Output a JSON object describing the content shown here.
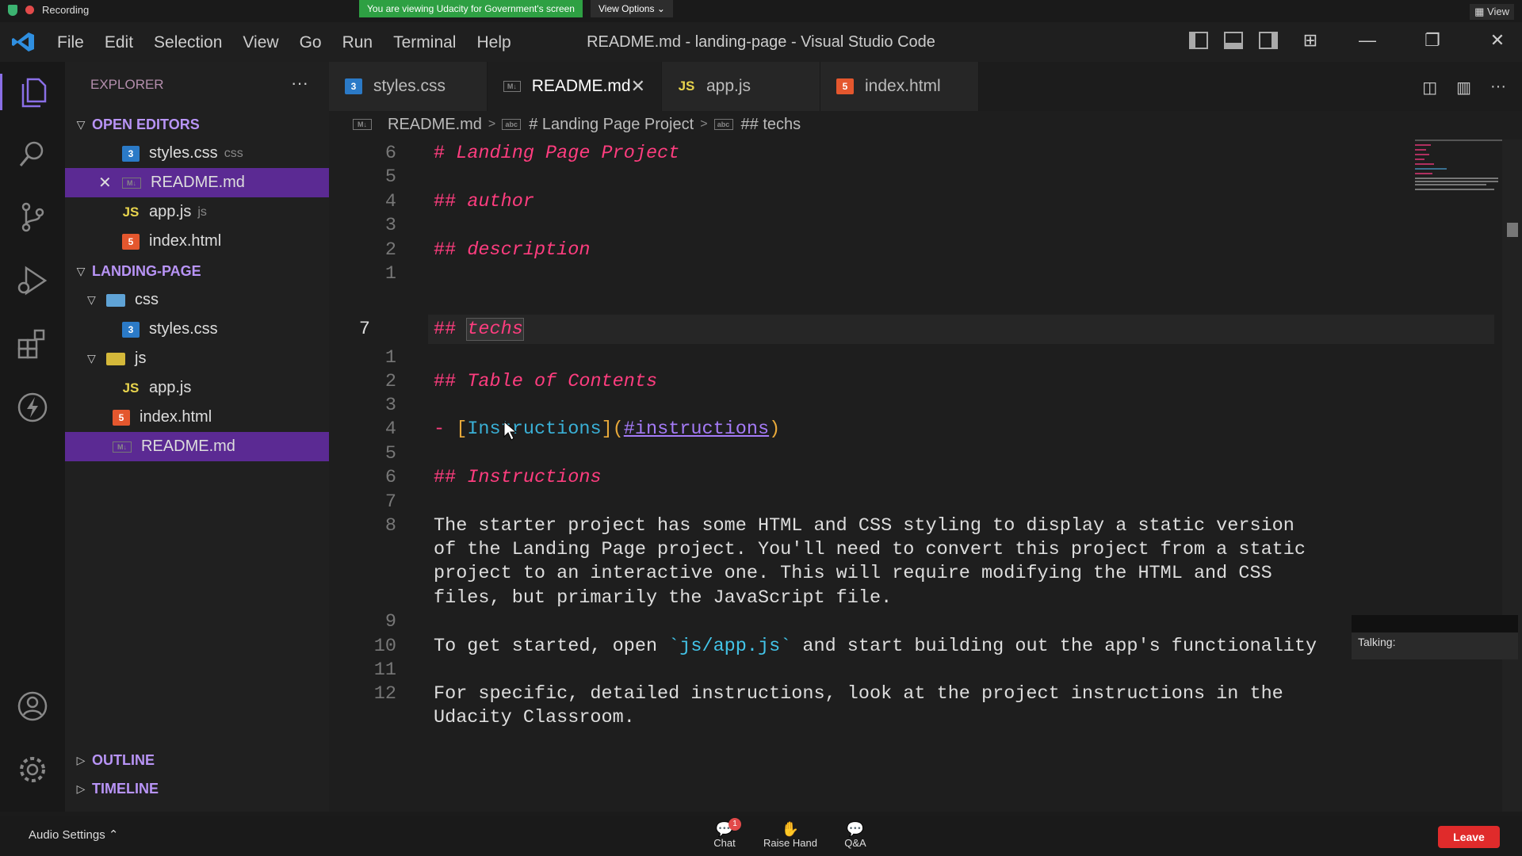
{
  "zoom_top": {
    "recording": "Recording",
    "viewing_banner": "You are viewing Udacity for Government's screen",
    "view_options": "View Options",
    "view": "View"
  },
  "window": {
    "title": "README.md - landing-page - Visual Studio Code",
    "menu": [
      "File",
      "Edit",
      "Selection",
      "View",
      "Go",
      "Run",
      "Terminal",
      "Help"
    ]
  },
  "sidebar": {
    "header": "EXPLORER",
    "open_editors_title": "OPEN EDITORS",
    "open_editors": [
      {
        "name": "styles.css",
        "suffix": "css",
        "icon": "css-file-icon"
      },
      {
        "name": "README.md",
        "suffix": "",
        "icon": "markdown-file-icon"
      },
      {
        "name": "app.js",
        "suffix": "js",
        "icon": "js-file-icon"
      },
      {
        "name": "index.html",
        "suffix": "",
        "icon": "html-file-icon"
      }
    ],
    "project_title": "LANDING-PAGE",
    "tree": {
      "css_folder": "css",
      "css_file": "styles.css",
      "js_folder": "js",
      "js_file": "app.js",
      "index": "index.html",
      "readme": "README.md"
    },
    "outline": "OUTLINE",
    "timeline": "TIMELINE"
  },
  "tabs": [
    {
      "label": "styles.css",
      "icon": "css-file-icon"
    },
    {
      "label": "README.md",
      "icon": "markdown-file-icon",
      "active": true
    },
    {
      "label": "app.js",
      "icon": "js-file-icon"
    },
    {
      "label": "index.html",
      "icon": "html-file-icon"
    }
  ],
  "breadcrumb": [
    "README.md",
    "# Landing Page Project",
    "## techs"
  ],
  "editor": {
    "gutter": [
      "6",
      "5",
      "4",
      "3",
      "2",
      "1",
      "7",
      "1",
      "2",
      "3",
      "4",
      "5",
      "6",
      "7",
      "8",
      "",
      "",
      "",
      "9",
      "10",
      "11",
      "12",
      ""
    ],
    "h1": "Landing Page Project",
    "h_author": "author",
    "h_description": "description",
    "h_techs": "techs",
    "h_toc": "Table of Contents",
    "link_text": "Instructions",
    "link_url": "#instructions",
    "h_instructions": "Instructions",
    "para1": [
      "The starter project has some HTML and CSS styling to display a static version",
      "of the Landing Page project. You'll need to convert this project from a static",
      "project to an interactive one. This will require modifying the HTML and CSS",
      "files, but primarily the JavaScript file."
    ],
    "para2_pre": "To get started, open ",
    "para2_code": "`js/app.js`",
    "para2_post": " and start building out the app's functionality",
    "para3": [
      "For specific, detailed instructions, look at the project instructions in the",
      "Udacity Classroom."
    ]
  },
  "overlay": {
    "talking": "Talking:"
  },
  "zoom_bottom": {
    "audio_settings": "Audio Settings",
    "chat": "Chat",
    "chat_badge": "1",
    "raise_hand": "Raise Hand",
    "qa": "Q&A",
    "leave": "Leave"
  }
}
